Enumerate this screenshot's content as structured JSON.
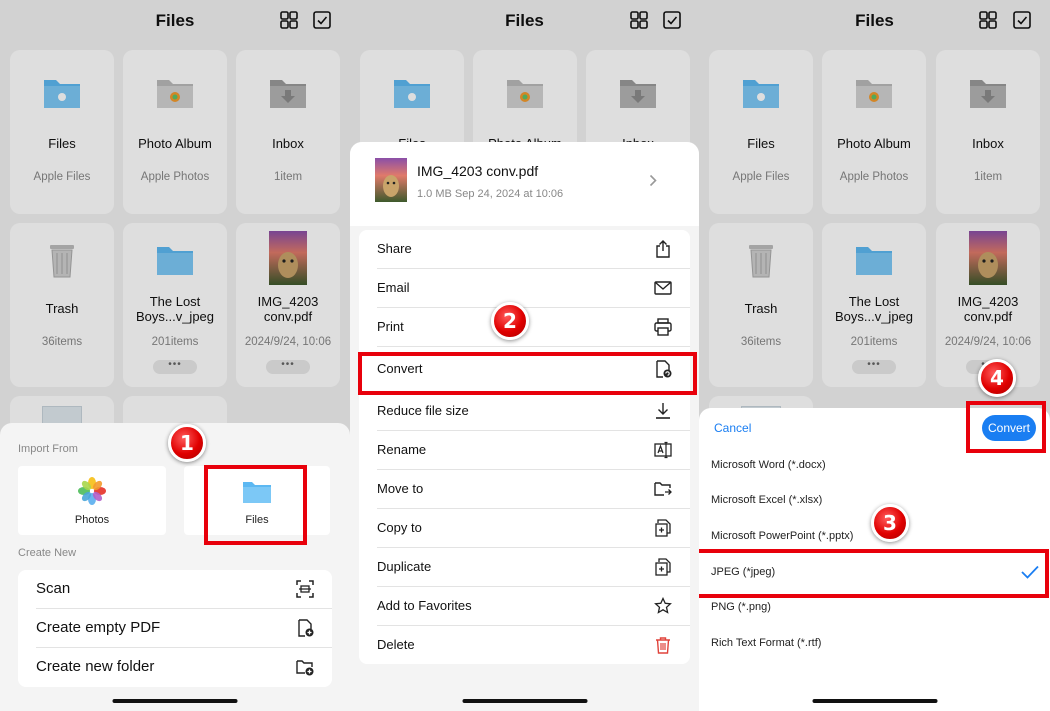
{
  "header": {
    "title": "Files"
  },
  "files": [
    {
      "name": "Files",
      "sub": "Apple Files",
      "icon": "folder-apple-icon"
    },
    {
      "name": "Photo Album",
      "sub": "Apple Photos",
      "icon": "photos-folder-icon"
    },
    {
      "name": "Inbox",
      "sub": "1item",
      "icon": "inbox-folder-icon"
    },
    {
      "name": "Trash",
      "sub": "36items",
      "icon": "trash-icon"
    },
    {
      "name": "The Lost Boys...v_jpeg",
      "sub": "201items",
      "icon": "folder-icon"
    },
    {
      "name": "IMG_4203 conv.pdf",
      "sub": "2024/9/24, 10:06",
      "icon": "pdf-thumbnail-icon"
    }
  ],
  "more_label": "•••",
  "import_sheet": {
    "import_from": "Import From",
    "photos": "Photos",
    "files": "Files",
    "create_new": "Create New",
    "items": [
      {
        "label": "Scan",
        "icon": "scan-icon"
      },
      {
        "label": "Create empty PDF",
        "icon": "new-pdf-icon"
      },
      {
        "label": "Create new folder",
        "icon": "new-folder-icon"
      }
    ]
  },
  "action_sheet": {
    "file_name": "IMG_4203 conv.pdf",
    "file_meta": "1.0 MB Sep 24, 2024 at 10:06",
    "actions": [
      {
        "label": "Share",
        "icon": "share-icon"
      },
      {
        "label": "Email",
        "icon": "envelope-icon"
      },
      {
        "label": "Print",
        "icon": "printer-icon"
      },
      {
        "label": "Convert",
        "icon": "convert-icon"
      },
      {
        "label": "Reduce file size",
        "icon": "download-icon"
      },
      {
        "label": "Rename",
        "icon": "rename-icon"
      },
      {
        "label": "Move to",
        "icon": "move-folder-icon"
      },
      {
        "label": "Copy to",
        "icon": "copy-icon"
      },
      {
        "label": "Duplicate",
        "icon": "duplicate-icon"
      },
      {
        "label": "Add to Favorites",
        "icon": "star-icon"
      },
      {
        "label": "Delete",
        "icon": "trash-red-icon"
      }
    ]
  },
  "convert_sheet": {
    "cancel": "Cancel",
    "convert": "Convert",
    "formats": [
      "Microsoft Word (*.docx)",
      "Microsoft Excel (*.xlsx)",
      "Microsoft PowerPoint (*.pptx)",
      "JPEG (*jpeg)",
      "PNG (*.png)",
      "Rich Text Format (*.rtf)"
    ],
    "selected": "JPEG (*jpeg)"
  },
  "steps": [
    "1",
    "2",
    "3",
    "4"
  ],
  "colors": {
    "accent": "#1a7ef2",
    "folder": "#5cb8f2",
    "highlight": "#e8000b",
    "delete": "#e0433b"
  }
}
